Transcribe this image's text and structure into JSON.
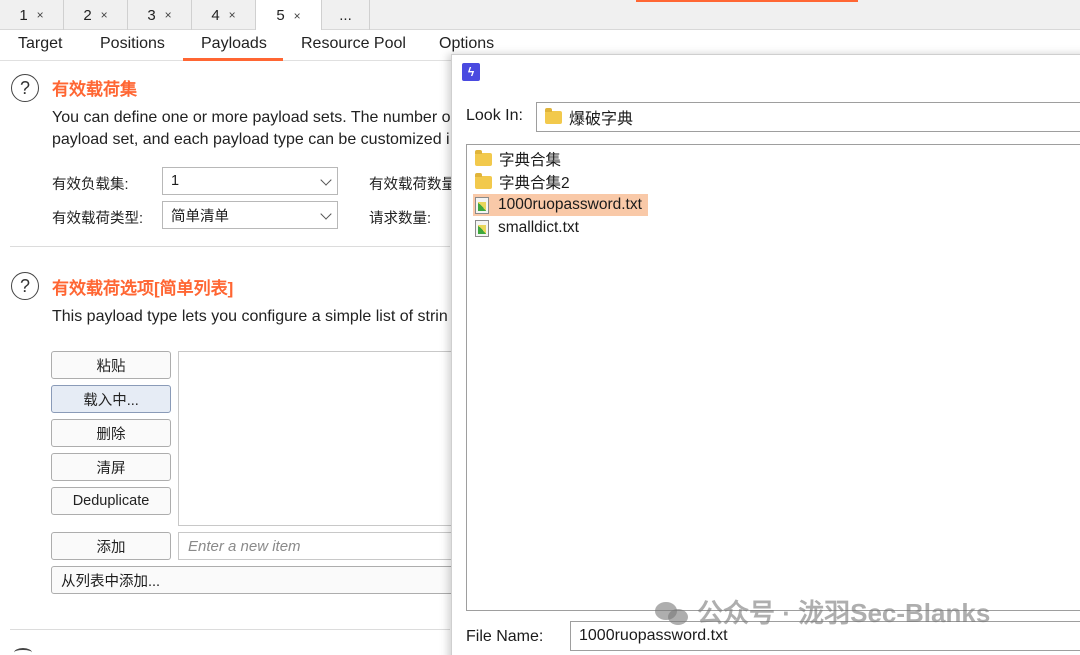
{
  "top_tabs": [
    {
      "label": "1",
      "close": "×"
    },
    {
      "label": "2",
      "close": "×"
    },
    {
      "label": "3",
      "close": "×"
    },
    {
      "label": "4",
      "close": "×"
    },
    {
      "label": "5",
      "close": "×"
    },
    {
      "label": "..."
    }
  ],
  "sub_tabs": [
    "Target",
    "Positions",
    "Payloads",
    "Resource Pool",
    "Options"
  ],
  "payload_sets": {
    "help": "?",
    "title": "有效载荷集",
    "desc_line1": "You can define one or more payload sets. The number o",
    "desc_line2": "payload set, and each payload type can be customized i",
    "set_label": "有效负载集:",
    "set_value": "1",
    "count_label": "有效载荷数量",
    "type_label": "有效载荷类型:",
    "type_value": "简单清单",
    "request_label": "请求数量:"
  },
  "payload_options": {
    "help": "?",
    "title": "有效载荷选项[简单列表]",
    "desc": "This payload type lets you configure a simple list of strin",
    "buttons": {
      "paste": "粘贴",
      "load": "载入中...",
      "remove": "删除",
      "clear": "清屏",
      "dedupe": "Deduplicate",
      "add": "添加"
    },
    "new_item_placeholder": "Enter a new item",
    "add_from_list": "从列表中添加..."
  },
  "dialog": {
    "app_icon": "ϟ",
    "look_in_label": "Look In:",
    "look_in_value": "爆破字典",
    "files": [
      {
        "name": "字典合集",
        "type": "folder"
      },
      {
        "name": "字典合集2",
        "type": "folder"
      },
      {
        "name": "1000ruopassword.txt",
        "type": "file",
        "selected": true
      },
      {
        "name": "smalldict.txt",
        "type": "file"
      }
    ],
    "file_name_label": "File Name:",
    "file_name_value": "1000ruopassword.txt"
  },
  "watermark": "公众号 · 泷羽Sec-Blanks",
  "colors": {
    "accent": "#ff6633",
    "selection": "#f9c9a8"
  }
}
